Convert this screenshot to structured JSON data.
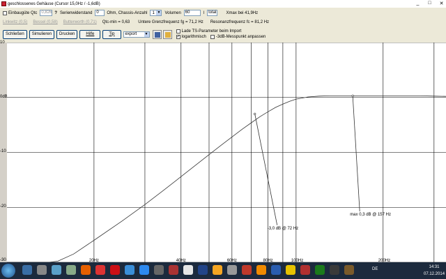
{
  "window": {
    "title": "geschlossenes Gehäuse (Cursor 15,0Hz / -1,6dB)",
    "controls": [
      "_",
      "□",
      "✕"
    ]
  },
  "row1": {
    "einbaugute_label": "Einbaugüte Qtc",
    "qtc_value": "0,826",
    "question": "?",
    "serienwiderstand_label": "Serienwiderstand",
    "serienwiderstand_value": "0",
    "ohm_label": "Ohm, Chassis-Anzahl",
    "chassis_value": "1",
    "volumen_label": "Volumen",
    "volumen_value": "60",
    "liter_label": "l",
    "total_label": "total",
    "xmax_text": "Xmax bei 41,9Hz"
  },
  "row2": {
    "linkwitz": "Linkwitz (0,5)",
    "bessel": "Bessel (0,58)",
    "butterworth": "Butterworth (0,71)",
    "qtc_min": "Qtc-min = 0,63",
    "grenzfrequenz": "Untere Grenzfrequenz fg = 71,2 Hz",
    "resonanz": "Resonanzfrequenz fc = 81,2 Hz"
  },
  "row3": {
    "buttons": [
      "Schließen",
      "Simulieren",
      "Drucken",
      "Hilfe",
      "Tip"
    ],
    "export_value": "export",
    "lade_ts": "Lade TS-Parameter beim Import",
    "logarithmisch": "logarithmisch",
    "messpunkt": "-3dB-Messpunkt anpassen"
  },
  "chart_data": {
    "type": "line",
    "title": "",
    "xlabel": "",
    "ylabel": "",
    "x_scale": "log",
    "xlim": [
      10,
      330
    ],
    "ylim": [
      -30,
      10
    ],
    "x_ticks": [
      {
        "value": 20,
        "label": "20Hz"
      },
      {
        "value": 40,
        "label": "40Hz"
      },
      {
        "value": 60,
        "label": "60Hz"
      },
      {
        "value": 80,
        "label": "80Hz"
      },
      {
        "value": 100,
        "label": "100Hz"
      },
      {
        "value": 200,
        "label": "200Hz"
      }
    ],
    "x_gridlines": [
      20,
      30,
      40,
      50,
      60,
      70,
      80,
      90,
      100,
      200,
      300
    ],
    "y_ticks": [
      {
        "value": 10,
        "label": "10"
      },
      {
        "value": 0,
        "label": "0dB"
      },
      {
        "value": -10,
        "label": "-10"
      },
      {
        "value": -20,
        "label": "-20"
      },
      {
        "value": -30,
        "label": "-30"
      }
    ],
    "grid": true,
    "series": [
      {
        "x": [
          10,
          14,
          15,
          17,
          20,
          25,
          30,
          35,
          40,
          45,
          50,
          55,
          60,
          65,
          70,
          75,
          80,
          85,
          90,
          95,
          100,
          110,
          120,
          130,
          140,
          150,
          157,
          170,
          190,
          210,
          240,
          270,
          300,
          330
        ],
        "y": [
          -30,
          -30,
          -29.8,
          -28.5,
          -26,
          -22.5,
          -19.5,
          -16.8,
          -14.4,
          -12.3,
          -10.4,
          -8.7,
          -7.2,
          -5.8,
          -4.6,
          -3.5,
          -2.6,
          -1.8,
          -1.2,
          -0.7,
          -0.3,
          0.1,
          0.25,
          0.3,
          0.3,
          0.3,
          0.3,
          0.3,
          0.3,
          0.3,
          0.3,
          0.3,
          0.25,
          0.2
        ]
      }
    ],
    "annotations": [
      {
        "text": "-3,0 dB @ 72 Hz",
        "point": [
          72,
          -3
        ],
        "label_at": [
          86,
          -24
        ]
      },
      {
        "text": "max 0,3 dB @ 157 Hz",
        "point": [
          157,
          0.3
        ],
        "label_at": [
          166,
          -21.5
        ]
      }
    ]
  },
  "taskbar": {
    "icons": [
      "app-1",
      "app-2",
      "app-3",
      "app-4",
      "firefox",
      "app-6",
      "opera",
      "app-8",
      "app-9",
      "app-10",
      "app-11",
      "app-12",
      "app-13",
      "app-14",
      "app-15",
      "app-16",
      "vlc",
      "app-18",
      "app-19",
      "app-20",
      "app-21",
      "app-22",
      "app-23"
    ],
    "colors": [
      "#3a6ea5",
      "#888888",
      "#5aa0c8",
      "#8a8",
      "#e66000",
      "#d33",
      "#cc0f16",
      "#3a8ed8",
      "#2d89ef",
      "#666",
      "#a33",
      "#e6e6e6",
      "#224488",
      "#f5a623",
      "#999",
      "#c0392b",
      "#f08a00",
      "#2a5db0",
      "#e6c200",
      "#b03030",
      "#1b7a1b",
      "#3a3a3a",
      "#7a5a2a"
    ],
    "language": "DE",
    "time": "14:31",
    "date": "07.12.2014"
  }
}
